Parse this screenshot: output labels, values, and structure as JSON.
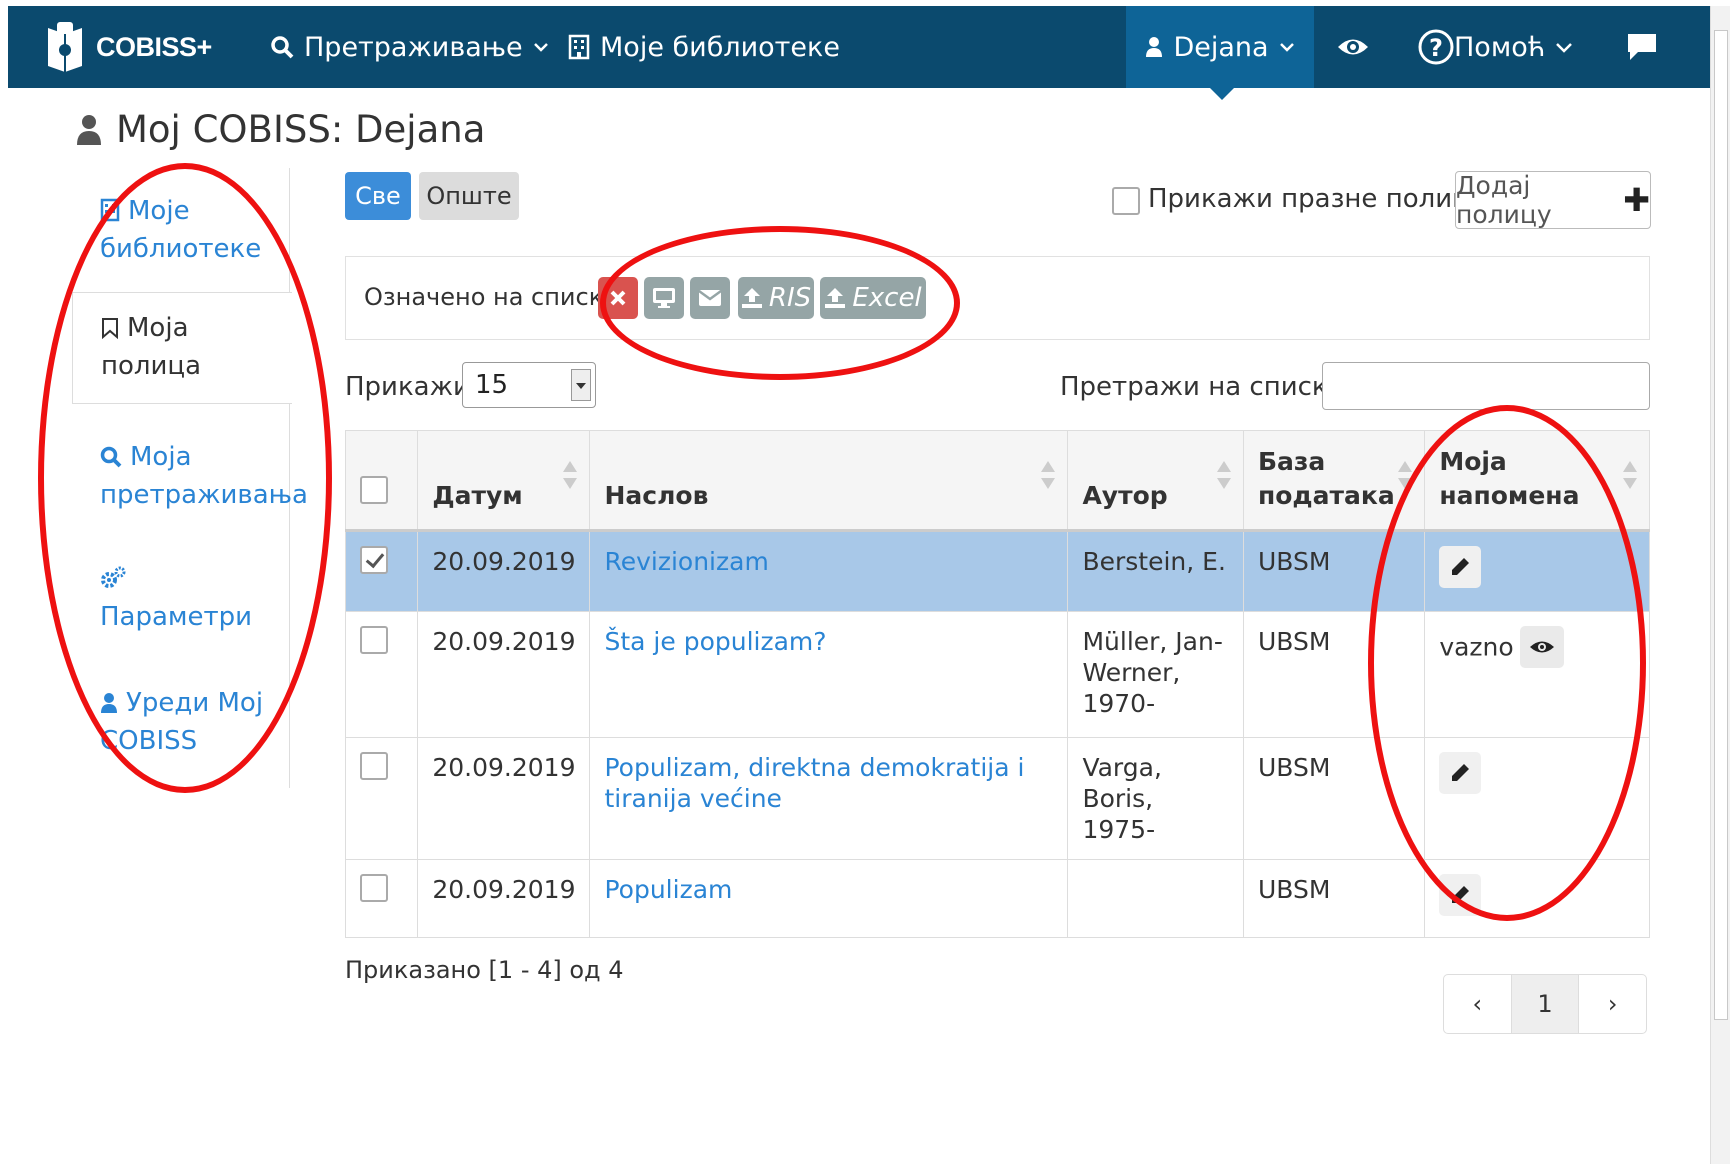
{
  "navbar": {
    "logo_text": "COBISS+",
    "search": "Претраживање",
    "my_libraries": "Моје библиотеке",
    "user": "Dejana",
    "help": "Помоћ"
  },
  "page": {
    "title": "Moj COBISS: Dejana"
  },
  "sidebar": {
    "items": [
      {
        "label": "Моје библиотеке",
        "icon": "building-icon"
      },
      {
        "label": "Моја полица",
        "icon": "bookmark-icon"
      },
      {
        "label": "Моја претраживања",
        "icon": "search-icon"
      },
      {
        "label": "Параметри",
        "icon": "gears-icon"
      },
      {
        "label": "Уреди Мој COBISS",
        "icon": "user-icon"
      }
    ]
  },
  "filters": {
    "all": "Све",
    "general": "Опште",
    "show_empty": "Прикажи празне полице",
    "add_shelf": "Додај полицу"
  },
  "marked": {
    "label": "Означено на списку",
    "ris": "RIS",
    "excel": "Excel"
  },
  "controls": {
    "show_label": "Прикажи",
    "show_value": "15",
    "search_label": "Претражи на списку:"
  },
  "table": {
    "headers": {
      "date": "Датум",
      "title": "Наслов",
      "author": "Аутор",
      "database": "База података",
      "note": "Моја напомена"
    },
    "rows": [
      {
        "date": "20.09.2019",
        "title": "Revizionizam",
        "author": "Berstein, E.",
        "database": "UBSM",
        "note": "",
        "checked": true
      },
      {
        "date": "20.09.2019",
        "title": "Šta je populizam?",
        "author": "Müller, Jan-Werner, 1970-",
        "database": "UBSM",
        "note": "vazno",
        "checked": false
      },
      {
        "date": "20.09.2019",
        "title": "Populizam, direktna demokratija i tiranija većine",
        "author": "Varga, Boris, 1975-",
        "database": "UBSM",
        "note": "",
        "checked": false
      },
      {
        "date": "20.09.2019",
        "title": "Populizam",
        "author": "",
        "database": "UBSM",
        "note": "",
        "checked": false
      }
    ]
  },
  "footer": {
    "info": "Приказано [1 - 4] од 4",
    "page": "1",
    "prev": "‹",
    "next": "›"
  },
  "colors": {
    "navbar": "#0b4a6e",
    "navbar_active": "#0e6497",
    "link": "#2a84d4",
    "selected_row": "#a8c8e8",
    "annotation": "#ee1111"
  }
}
